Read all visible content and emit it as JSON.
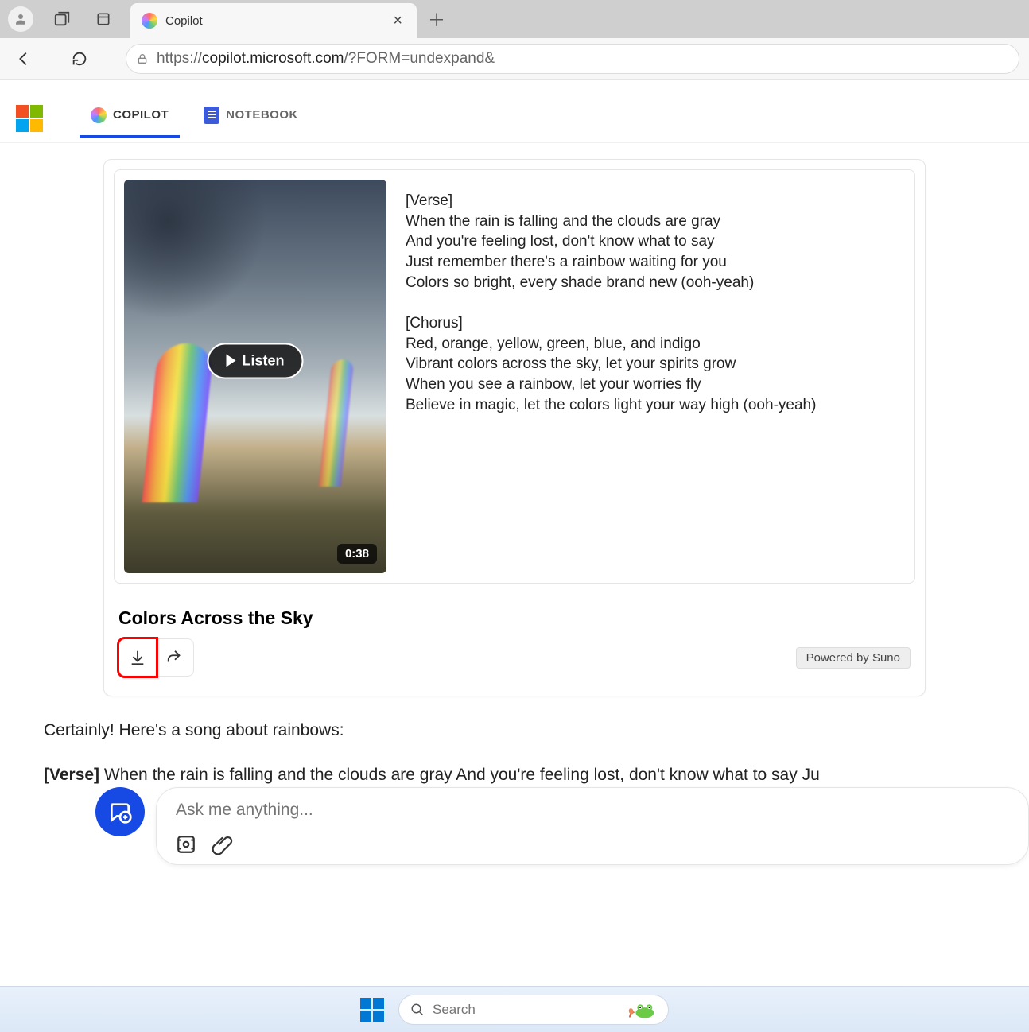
{
  "browser": {
    "tab_title": "Copilot",
    "url_prefix": "https://",
    "url_host": "copilot.microsoft.com",
    "url_path": "/?FORM=undexpand&"
  },
  "nav": {
    "copilot": "COPILOT",
    "notebook": "NOTEBOOK"
  },
  "song": {
    "listen": "Listen",
    "duration": "0:38",
    "title": "Colors Across the Sky",
    "powered": "Powered by Suno",
    "verse_label": "[Verse]",
    "verse_lines": "When the rain is falling and the clouds are gray\nAnd you're feeling lost, don't know what to say\nJust remember there's a rainbow waiting for you\nColors so bright, every shade brand new (ooh-yeah)",
    "chorus_label": "[Chorus]",
    "chorus_lines": "Red, orange, yellow, green, blue, and indigo\nVibrant colors across the sky, let your spirits grow\nWhen you see a rainbow, let your worries fly\nBelieve in magic, let the colors light your way high (ooh-yeah)"
  },
  "response": {
    "intro": "Certainly! Here's a song about rainbows:",
    "verse_tag": "[Verse]",
    "verse_inline": " When the rain is falling and the clouds are gray And you're feeling lost, don't know what to say Ju"
  },
  "input": {
    "placeholder": "Ask me anything..."
  },
  "taskbar": {
    "search_placeholder": "Search"
  }
}
